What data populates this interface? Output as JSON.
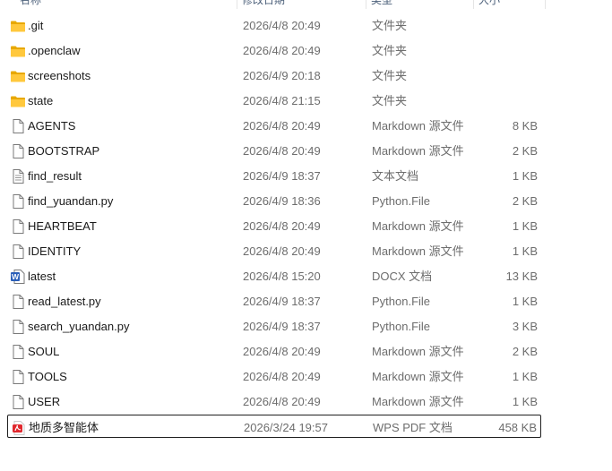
{
  "header": {
    "col_name": "名称",
    "col_date": "修改日期",
    "col_type": "类型",
    "col_size": "大小"
  },
  "files": [
    {
      "name": ".git",
      "date": "2026/4/8 20:49",
      "type": "文件夹",
      "size": "",
      "icon": "folder-icon"
    },
    {
      "name": ".openclaw",
      "date": "2026/4/8 20:49",
      "type": "文件夹",
      "size": "",
      "icon": "folder-icon"
    },
    {
      "name": "screenshots",
      "date": "2026/4/9 20:18",
      "type": "文件夹",
      "size": "",
      "icon": "folder-icon"
    },
    {
      "name": "state",
      "date": "2026/4/8 21:15",
      "type": "文件夹",
      "size": "",
      "icon": "folder-icon"
    },
    {
      "name": "AGENTS",
      "date": "2026/4/8 20:49",
      "type": "Markdown 源文件",
      "size": "8 KB",
      "icon": "file-icon"
    },
    {
      "name": "BOOTSTRAP",
      "date": "2026/4/8 20:49",
      "type": "Markdown 源文件",
      "size": "2 KB",
      "icon": "file-icon"
    },
    {
      "name": "find_result",
      "date": "2026/4/9 18:37",
      "type": "文本文档",
      "size": "1 KB",
      "icon": "text-file-icon"
    },
    {
      "name": "find_yuandan.py",
      "date": "2026/4/9 18:36",
      "type": "Python.File",
      "size": "2 KB",
      "icon": "file-icon"
    },
    {
      "name": "HEARTBEAT",
      "date": "2026/4/8 20:49",
      "type": "Markdown 源文件",
      "size": "1 KB",
      "icon": "file-icon"
    },
    {
      "name": "IDENTITY",
      "date": "2026/4/8 20:49",
      "type": "Markdown 源文件",
      "size": "1 KB",
      "icon": "file-icon"
    },
    {
      "name": "latest",
      "date": "2026/4/8 15:20",
      "type": "DOCX 文档",
      "size": "13 KB",
      "icon": "word-doc-icon"
    },
    {
      "name": "read_latest.py",
      "date": "2026/4/9 18:37",
      "type": "Python.File",
      "size": "1 KB",
      "icon": "file-icon"
    },
    {
      "name": "search_yuandan.py",
      "date": "2026/4/9 18:37",
      "type": "Python.File",
      "size": "3 KB",
      "icon": "file-icon"
    },
    {
      "name": "SOUL",
      "date": "2026/4/8 20:49",
      "type": "Markdown 源文件",
      "size": "2 KB",
      "icon": "file-icon"
    },
    {
      "name": "TOOLS",
      "date": "2026/4/8 20:49",
      "type": "Markdown 源文件",
      "size": "1 KB",
      "icon": "file-icon"
    },
    {
      "name": "USER",
      "date": "2026/4/8 20:49",
      "type": "Markdown 源文件",
      "size": "1 KB",
      "icon": "file-icon"
    },
    {
      "name": "地质多智能体",
      "date": "2026/3/24 19:57",
      "type": "WPS PDF 文档",
      "size": "458 KB",
      "icon": "pdf-icon",
      "selected": true
    }
  ]
}
